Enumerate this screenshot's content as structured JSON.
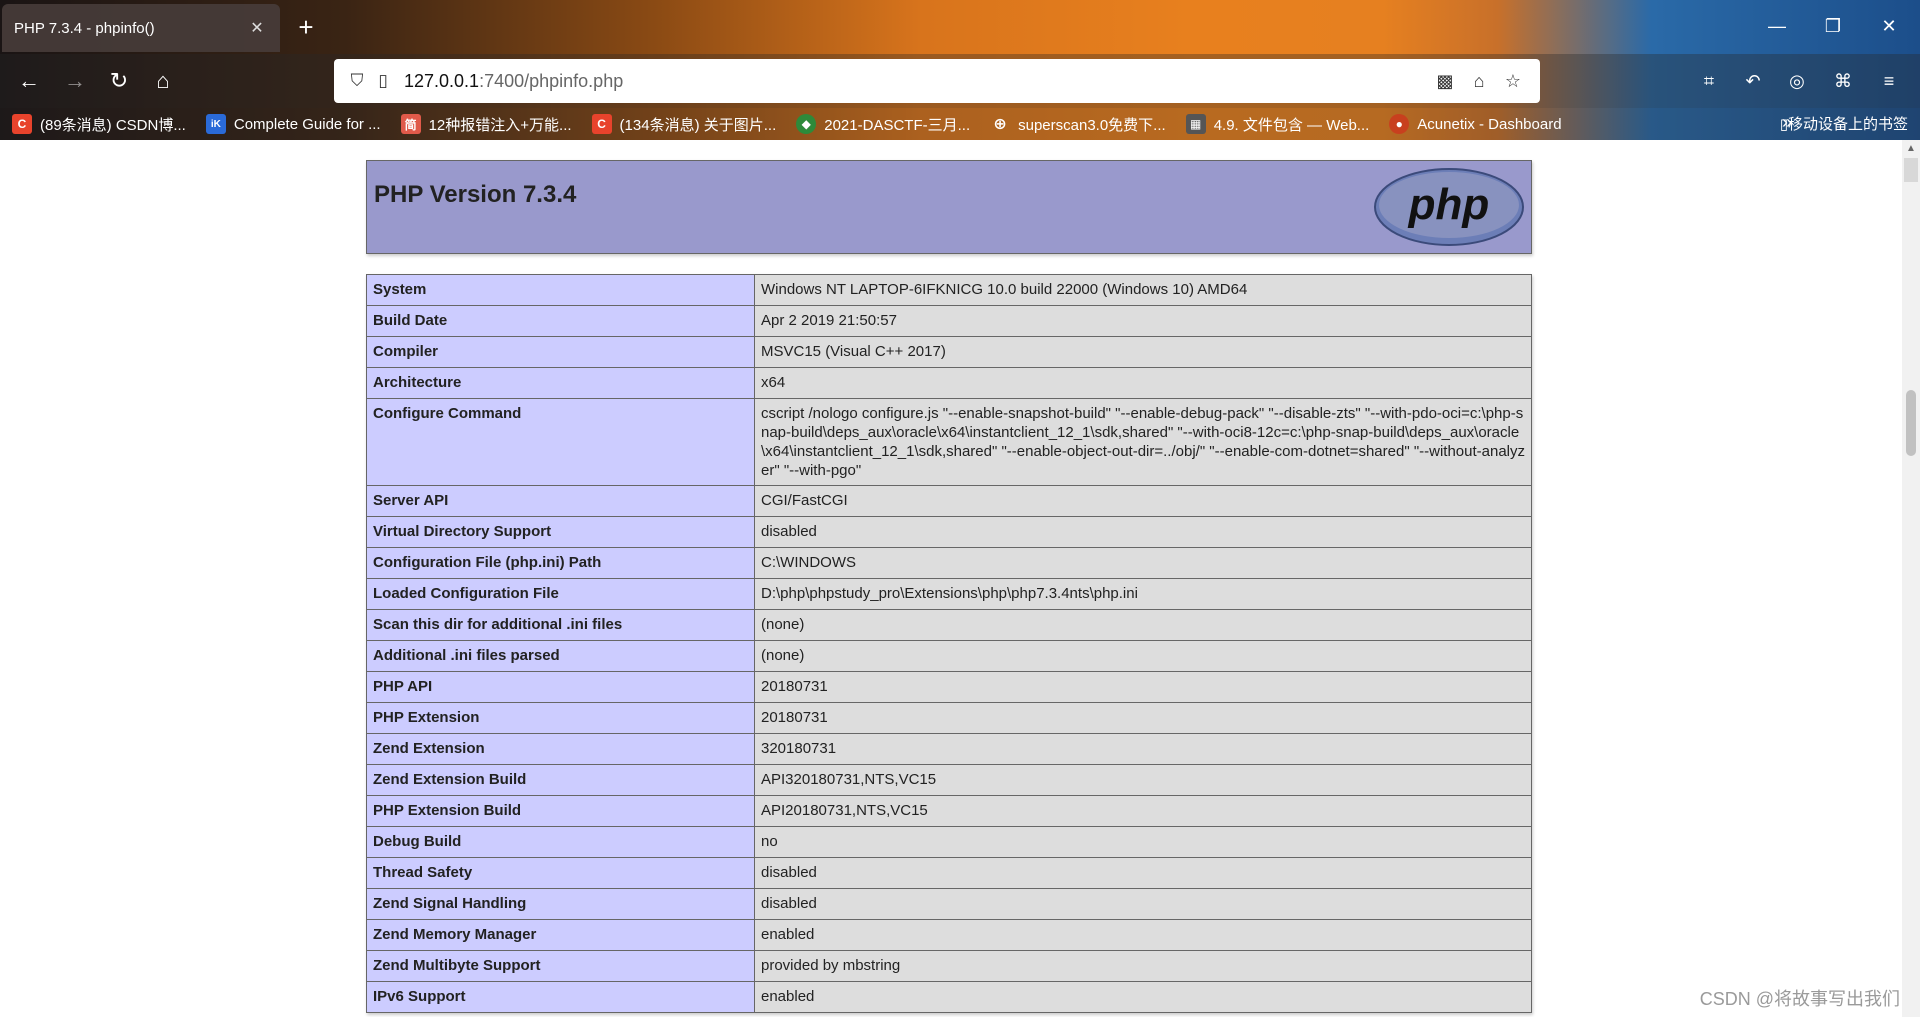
{
  "browser": {
    "tab_title": "PHP 7.3.4 - phpinfo()",
    "tab_close": "✕",
    "new_tab": "+",
    "url_host": "127.0.0.1",
    "url_rest": ":7400/phpinfo.php",
    "window": {
      "minimize": "—",
      "restore": "❐",
      "close": "✕"
    },
    "bookmarks": [
      {
        "label": "(89条消息) CSDN博...",
        "icon": "csdn-icon",
        "icon_text": "C",
        "color": "#e8432c"
      },
      {
        "label": "Complete Guide for ...",
        "icon": "ik-icon",
        "icon_text": "iK",
        "color": "#2a6ad8"
      },
      {
        "label": "12种报错注入+万能...",
        "icon": "jian-icon",
        "icon_text": "简",
        "color": "#e05a4a"
      },
      {
        "label": "(134条消息) 关于图片...",
        "icon": "csdn-icon",
        "icon_text": "C",
        "color": "#e8432c"
      },
      {
        "label": "2021-DASCTF-三月...",
        "icon": "shield-icon",
        "icon_text": "◆",
        "color": "#2e8a3a"
      },
      {
        "label": "superscan3.0免费下...",
        "icon": "globe-icon",
        "icon_text": "⊕",
        "color": "transparent"
      },
      {
        "label": "4.9. 文件包含 — Web...",
        "icon": "book-icon",
        "icon_text": "▦",
        "color": "#555555"
      },
      {
        "label": "Acunetix - Dashboard",
        "icon": "acunetix-icon",
        "icon_text": "●",
        "color": "#c8401e"
      }
    ],
    "bookmarks_more": "»",
    "mobile_bookmarks": "▯移动设备上的书签"
  },
  "page": {
    "title": "PHP Version 7.3.4",
    "logo_text": "php",
    "rows": [
      {
        "key": "System",
        "value": "Windows NT LAPTOP-6IFKNICG 10.0 build 22000 (Windows 10) AMD64"
      },
      {
        "key": "Build Date",
        "value": "Apr 2 2019 21:50:57"
      },
      {
        "key": "Compiler",
        "value": "MSVC15 (Visual C++ 2017)"
      },
      {
        "key": "Architecture",
        "value": "x64"
      },
      {
        "key": "Configure Command",
        "value": "cscript /nologo configure.js \"--enable-snapshot-build\" \"--enable-debug-pack\" \"--disable-zts\" \"--with-pdo-oci=c:\\php-snap-build\\deps_aux\\oracle\\x64\\instantclient_12_1\\sdk,shared\" \"--with-oci8-12c=c:\\php-snap-build\\deps_aux\\oracle\\x64\\instantclient_12_1\\sdk,shared\" \"--enable-object-out-dir=../obj/\" \"--enable-com-dotnet=shared\" \"--without-analyzer\" \"--with-pgo\""
      },
      {
        "key": "Server API",
        "value": "CGI/FastCGI"
      },
      {
        "key": "Virtual Directory Support",
        "value": "disabled"
      },
      {
        "key": "Configuration File (php.ini) Path",
        "value": "C:\\WINDOWS"
      },
      {
        "key": "Loaded Configuration File",
        "value": "D:\\php\\phpstudy_pro\\Extensions\\php\\php7.3.4nts\\php.ini"
      },
      {
        "key": "Scan this dir for additional .ini files",
        "value": "(none)"
      },
      {
        "key": "Additional .ini files parsed",
        "value": "(none)"
      },
      {
        "key": "PHP API",
        "value": "20180731"
      },
      {
        "key": "PHP Extension",
        "value": "20180731"
      },
      {
        "key": "Zend Extension",
        "value": "320180731"
      },
      {
        "key": "Zend Extension Build",
        "value": "API320180731,NTS,VC15"
      },
      {
        "key": "PHP Extension Build",
        "value": "API20180731,NTS,VC15"
      },
      {
        "key": "Debug Build",
        "value": "no"
      },
      {
        "key": "Thread Safety",
        "value": "disabled"
      },
      {
        "key": "Zend Signal Handling",
        "value": "disabled"
      },
      {
        "key": "Zend Memory Manager",
        "value": "enabled"
      },
      {
        "key": "Zend Multibyte Support",
        "value": "provided by mbstring"
      },
      {
        "key": "IPv6 Support",
        "value": "enabled"
      }
    ]
  },
  "watermark": "CSDN @将故事写出我们",
  "colors": {
    "header_bg": "#9999cc",
    "key_bg": "#ccccff",
    "value_bg": "#dddddd"
  }
}
